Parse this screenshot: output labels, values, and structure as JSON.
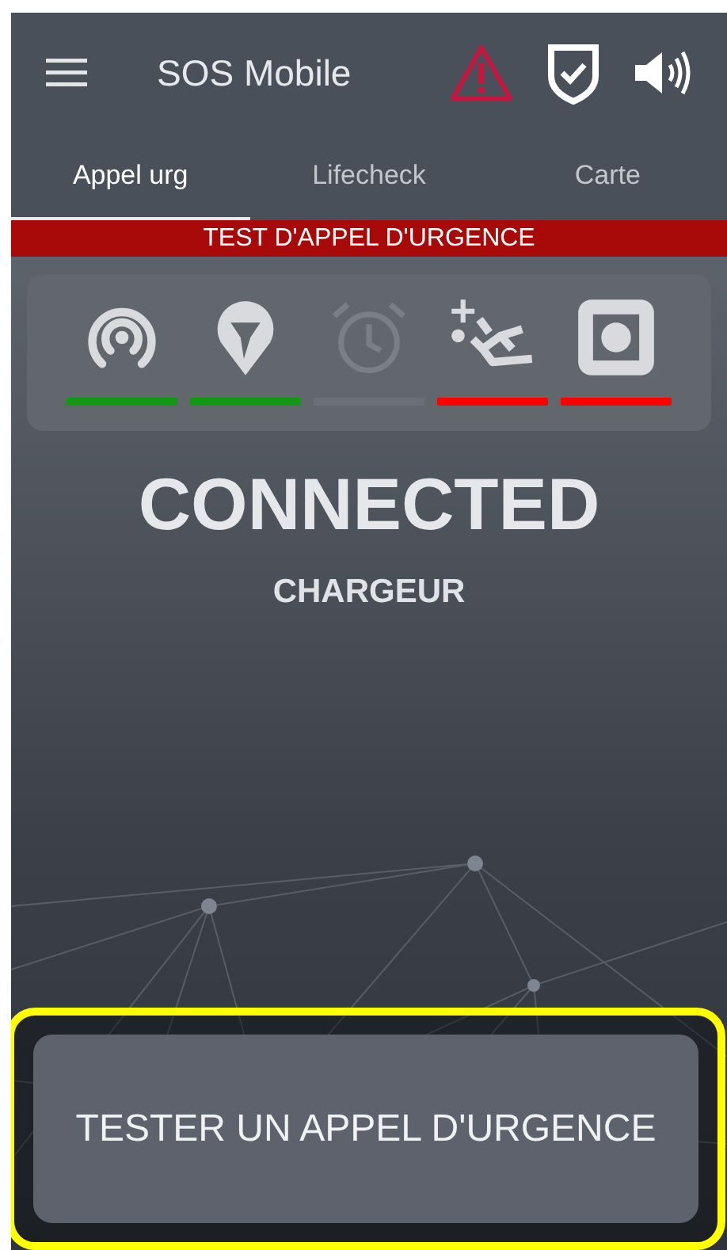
{
  "app_bar": {
    "title": "SOS Mobile",
    "alert_active": true
  },
  "tabs": [
    {
      "label": "Appel urg",
      "selected": true
    },
    {
      "label": "Lifecheck",
      "selected": false
    },
    {
      "label": "Carte",
      "selected": false
    }
  ],
  "banner": "TEST D'APPEL D'URGENCE",
  "sensors": [
    {
      "kind": "signal",
      "color": "#119a11",
      "disabled": false
    },
    {
      "kind": "location",
      "color": "#119a11",
      "disabled": false
    },
    {
      "kind": "alarm",
      "color": "#6b6f76",
      "disabled": true
    },
    {
      "kind": "fall",
      "color": "#ff0000",
      "disabled": false
    },
    {
      "kind": "button",
      "color": "#ff0000",
      "disabled": false
    }
  ],
  "status": "CONNECTED",
  "substatus": "CHARGEUR",
  "action_button": {
    "label": "TESTER UN APPEL D'URGENCE",
    "highlighted": true
  }
}
